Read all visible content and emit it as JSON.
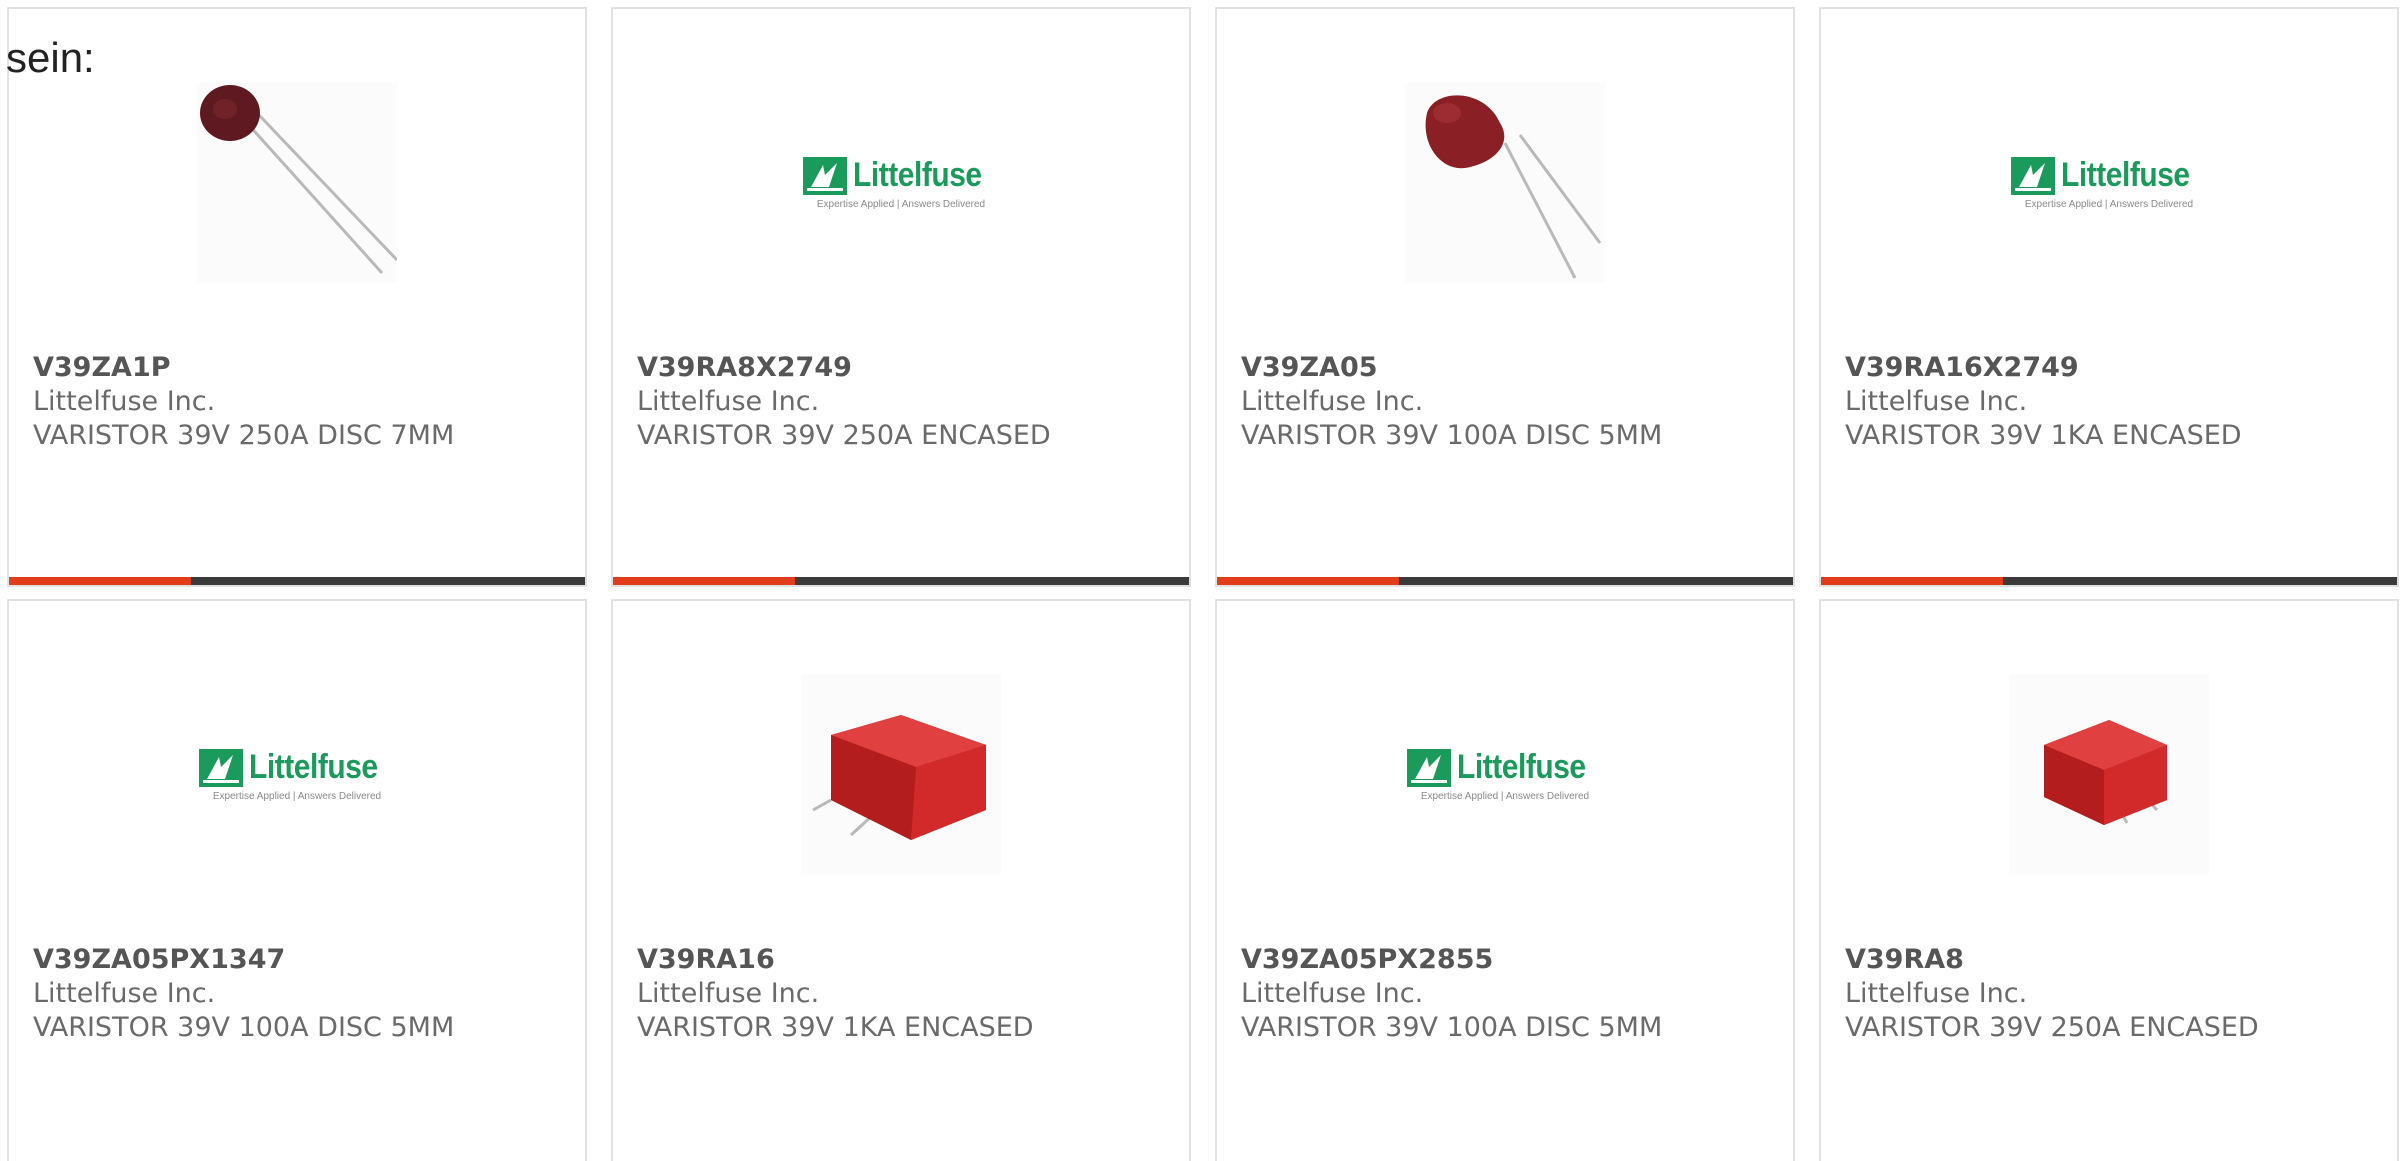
{
  "intro_text": "sein:",
  "logo": {
    "brand": "Littelfuse",
    "tagline": "Expertise Applied  |  Answers Delivered"
  },
  "colors": {
    "accent": "#e23c1a",
    "bar_dark": "#3b3b3b",
    "brand_green": "#1a9a5b",
    "varistor_disc": "#7a1f22",
    "encased_red": "#d42a22"
  },
  "products": [
    {
      "part_number": "V39ZA1P",
      "manufacturer": "Littelfuse Inc.",
      "description": "VARISTOR 39V 250A DISC 7MM",
      "image": "disc-varistor-photo"
    },
    {
      "part_number": "V39RA8X2749",
      "manufacturer": "Littelfuse Inc.",
      "description": "VARISTOR 39V 250A ENCASED",
      "image": "littelfuse-logo"
    },
    {
      "part_number": "V39ZA05",
      "manufacturer": "Littelfuse Inc.",
      "description": "VARISTOR 39V 100A DISC 5MM",
      "image": "disc-varistor-photo"
    },
    {
      "part_number": "V39RA16X2749",
      "manufacturer": "Littelfuse Inc.",
      "description": "VARISTOR 39V 1KA ENCASED",
      "image": "littelfuse-logo"
    },
    {
      "part_number": "V39ZA05PX1347",
      "manufacturer": "Littelfuse Inc.",
      "description": "VARISTOR 39V 100A DISC 5MM",
      "image": "littelfuse-logo"
    },
    {
      "part_number": "V39RA16",
      "manufacturer": "Littelfuse Inc.",
      "description": "VARISTOR 39V 1KA ENCASED",
      "image": "encased-varistor-photo"
    },
    {
      "part_number": "V39ZA05PX2855",
      "manufacturer": "Littelfuse Inc.",
      "description": "VARISTOR 39V 100A DISC 5MM",
      "image": "littelfuse-logo"
    },
    {
      "part_number": "V39RA8",
      "manufacturer": "Littelfuse Inc.",
      "description": "VARISTOR 39V 250A ENCASED",
      "image": "encased-varistor-photo"
    }
  ]
}
